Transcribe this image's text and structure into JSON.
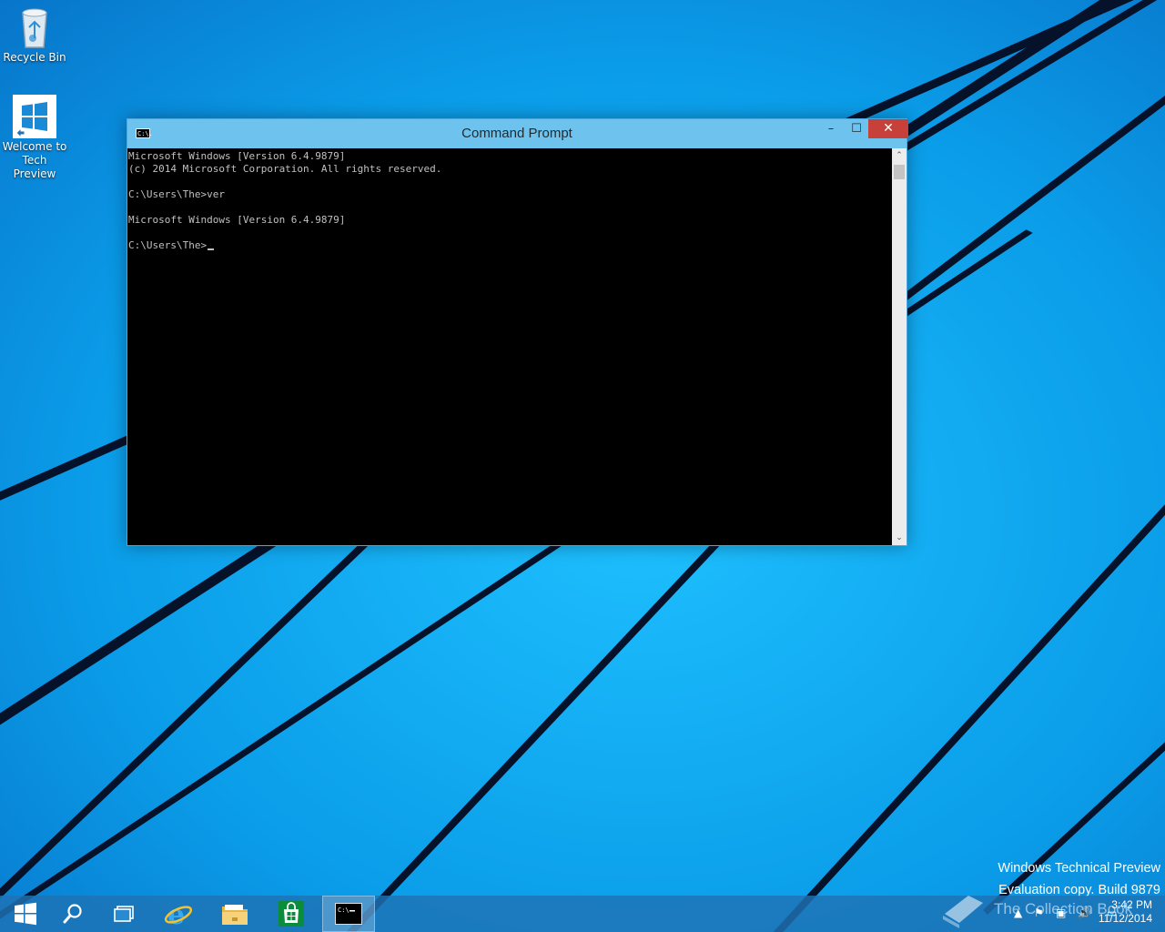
{
  "desktop": {
    "icons": [
      {
        "label": "Recycle Bin",
        "icon": "recycle-bin-icon"
      },
      {
        "label": "Welcome to\nTech Preview",
        "icon": "windows-logo-icon"
      }
    ]
  },
  "window": {
    "title": "Command Prompt",
    "app_icon_text": "C:\\.",
    "minimize": "–",
    "maximize": "☐",
    "close": "✕",
    "console_lines": [
      "Microsoft Windows [Version 6.4.9879]",
      "(c) 2014 Microsoft Corporation. All rights reserved.",
      "",
      "C:\\Users\\The>ver",
      "",
      "Microsoft Windows [Version 6.4.9879]",
      "",
      "C:\\Users\\The>"
    ],
    "scroll_up": "⌃",
    "scroll_down": "⌄"
  },
  "watermark": {
    "line1": "Windows Technical Preview",
    "line2": "Evaluation copy. Build 9879"
  },
  "taskbar": {
    "items": [
      {
        "name": "start",
        "icon": "windows-start-icon"
      },
      {
        "name": "search",
        "icon": "search-icon"
      },
      {
        "name": "task-view",
        "icon": "task-view-icon"
      },
      {
        "name": "internet-explorer",
        "icon": "internet-explorer-icon"
      },
      {
        "name": "file-explorer",
        "icon": "folder-icon"
      },
      {
        "name": "store",
        "icon": "store-icon"
      },
      {
        "name": "command-prompt",
        "icon": "command-prompt-icon"
      }
    ],
    "tray": {
      "time": "3:42 PM",
      "date": "11/12/2014"
    },
    "overlay_text": "The Collection Book"
  },
  "colors": {
    "accent": "#0a9ef0",
    "titlebar": "#6ec2ee",
    "close": "#c7413a",
    "store_green": "#0a8c3a"
  }
}
